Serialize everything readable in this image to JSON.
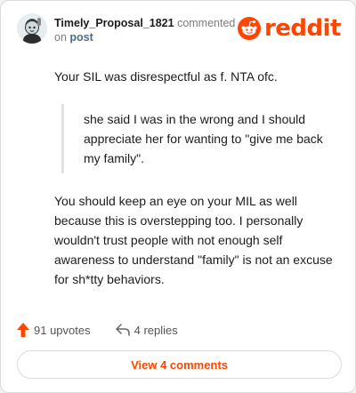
{
  "comment": {
    "username": "Timely_Proposal_1821",
    "action_text": "commented",
    "on_text": "on",
    "target_text": "post",
    "body_intro": "Your SIL was disrespectful as f. NTA ofc.",
    "quote": "she said I was in the wrong and I should appreciate her for wanting to \"give me back my family\".",
    "body_main": "You should keep an eye on your MIL as well because this is overstepping too. I personally wouldn't trust people with not enough self awareness to understand \"family\" is not an excuse for sh*tty behaviors."
  },
  "brand": {
    "wordmark": "reddit",
    "color": "#ff4500",
    "icon": "reddit-logo-icon"
  },
  "actions": {
    "upvotes_label": "91 upvotes",
    "upvote_icon": "upvote-arrow-icon",
    "replies_label": "4 replies",
    "reply_icon": "reply-icon"
  },
  "footer": {
    "view_comments_label": "View 4 comments"
  }
}
